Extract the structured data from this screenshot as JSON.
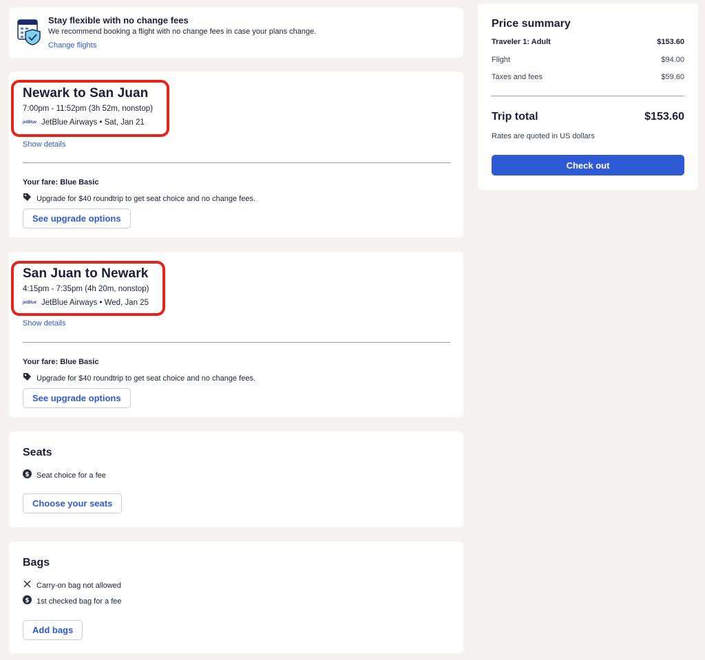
{
  "banner": {
    "title": "Stay flexible with no change fees",
    "message": "We recommend booking a flight with no change fees in case your plans change.",
    "link": "Change flights"
  },
  "flights": [
    {
      "title": "Newark to San Juan",
      "times": "7:00pm - 11:52pm (3h 52m, nonstop)",
      "airline_line": "JetBlue Airways • Sat, Jan 21",
      "show_details": "Show details",
      "fare": "Your fare: Blue Basic",
      "upgrade_text": "Upgrade for $40 roundtrip to get seat choice and no change fees.",
      "upgrade_button": "See upgrade options"
    },
    {
      "title": "San Juan to Newark",
      "times": "4:15pm - 7:35pm (4h 20m, nonstop)",
      "airline_line": "JetBlue Airways • Wed, Jan 25",
      "show_details": "Show details",
      "fare": "Your fare: Blue Basic",
      "upgrade_text": "Upgrade for $40 roundtrip to get seat choice and no change fees.",
      "upgrade_button": "See upgrade options"
    }
  ],
  "seats": {
    "title": "Seats",
    "info": "Seat choice for a fee",
    "button": "Choose your seats"
  },
  "bags": {
    "title": "Bags",
    "carry_on": "Carry-on bag not allowed",
    "checked": "1st checked bag for a fee",
    "button": "Add bags"
  },
  "price_summary": {
    "title": "Price summary",
    "traveler_label": "Traveler 1: Adult",
    "traveler_amount": "$153.60",
    "flight_label": "Flight",
    "flight_amount": "$94.00",
    "taxes_label": "Taxes and fees",
    "taxes_amount": "$59.60",
    "total_label": "Trip total",
    "total_amount": "$153.60",
    "note": "Rates are quoted in US dollars",
    "checkout": "Check out"
  },
  "colors": {
    "accent": "#2e5ad6",
    "highlight": "#e5251a",
    "background": "#f4f1ee"
  }
}
